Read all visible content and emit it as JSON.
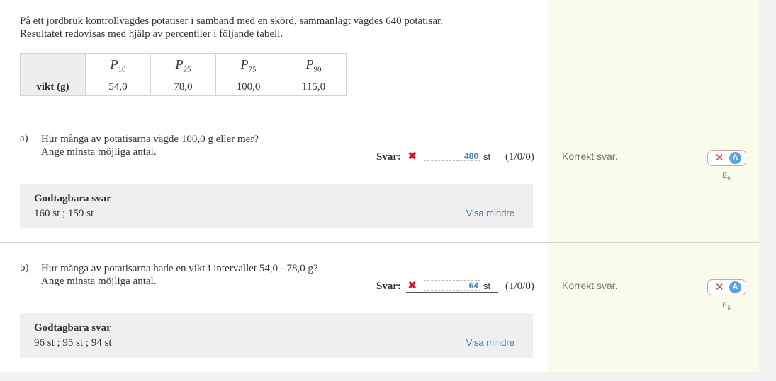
{
  "intro": {
    "line1": "På ett jordbruk kontrollvägdes potatiser i samband med en skörd, sammanlagt vägdes 640 potatisar.",
    "line2": "Resultatet redovisas med hjälp av percentiler i följande tabell."
  },
  "table": {
    "headers": [
      {
        "sym": "P",
        "sub": "10"
      },
      {
        "sym": "P",
        "sub": "25"
      },
      {
        "sym": "P",
        "sub": "75"
      },
      {
        "sym": "P",
        "sub": "90"
      }
    ],
    "row_label": "vikt (g)",
    "values": [
      "54,0",
      "78,0",
      "100,0",
      "115,0"
    ]
  },
  "questions": [
    {
      "letter": "a)",
      "line1": "Hur många av potatisarna vägde 100,0 g eller mer?",
      "line2": "Ange minsta möjliga antal.",
      "svar_label": "Svar:",
      "answer": "480",
      "unit": "st",
      "points": "(1/0/0)",
      "feedback": "Korrekt svar.",
      "badge_letter": "A",
      "level": {
        "letter": "E",
        "sub": "b"
      },
      "accept_title": "Godtagbara svar",
      "accept_values": "160 st ; 159 st",
      "toggle": "Visa mindre"
    },
    {
      "letter": "b)",
      "line1": "Hur många av potatisarna hade en vikt i intervallet 54,0 - 78,0 g?",
      "line2": "Ange minsta möjliga antal.",
      "svar_label": "Svar:",
      "answer": "64",
      "unit": "st",
      "points": "(1/0/0)",
      "feedback": "Korrekt svar.",
      "badge_letter": "A",
      "level": {
        "letter": "E",
        "sub": "b"
      },
      "accept_title": "Godtagbara svar",
      "accept_values": "96 st ; 95 st ; 94 st",
      "toggle": "Visa mindre"
    }
  ],
  "colors": {
    "wrong": "#cc1f1f",
    "answer_text": "#4d87c7",
    "side_bg": "#fbfbeb",
    "link": "#3d79b7"
  }
}
